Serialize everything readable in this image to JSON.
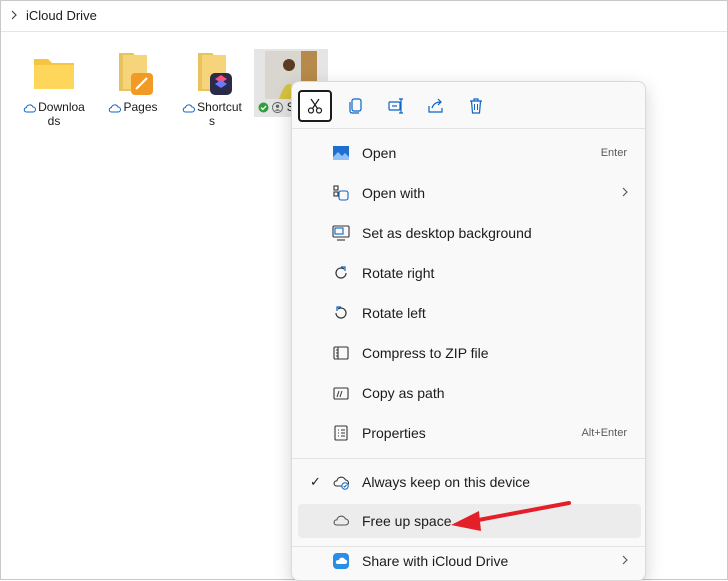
{
  "breadcrumb": {
    "location": "iCloud Drive"
  },
  "files": [
    {
      "name_line1": "Downloa",
      "name_line2": "ds",
      "type": "folder"
    },
    {
      "name_line1": "Pages",
      "name_line2": "",
      "type": "folder-app"
    },
    {
      "name_line1": "Shortcut",
      "name_line2": "s",
      "type": "folder-app"
    },
    {
      "name_line1": "S",
      "name_line2": "",
      "type": "image",
      "selected": true
    }
  ],
  "context_menu": {
    "toolbar": [
      "cut-icon",
      "copy-icon",
      "rename-icon",
      "share-icon",
      "delete-icon"
    ],
    "items": [
      {
        "label": "Open",
        "shortcut": "Enter",
        "icon": "image-icon"
      },
      {
        "label": "Open with",
        "shortcut": "",
        "icon": "open-with-icon",
        "submenu": true
      },
      {
        "label": "Set as desktop background",
        "shortcut": "",
        "icon": "desktop-background-icon"
      },
      {
        "label": "Rotate right",
        "shortcut": "",
        "icon": "rotate-right-icon"
      },
      {
        "label": "Rotate left",
        "shortcut": "",
        "icon": "rotate-left-icon"
      },
      {
        "label": "Compress to ZIP file",
        "shortcut": "",
        "icon": "zip-icon"
      },
      {
        "label": "Copy as path",
        "shortcut": "",
        "icon": "copy-path-icon"
      },
      {
        "label": "Properties",
        "shortcut": "Alt+Enter",
        "icon": "properties-icon"
      },
      {
        "label": "Always keep on this device",
        "shortcut": "",
        "icon": "cloud-sync-icon",
        "checked": true
      },
      {
        "label": "Free up space",
        "shortcut": "",
        "icon": "cloud-icon",
        "hover": true
      },
      {
        "label": "Share with iCloud Drive",
        "shortcut": "",
        "icon": "icloud-icon",
        "submenu": true
      }
    ],
    "check_mark": "✓"
  },
  "colors": {
    "annotation": "#e3202a",
    "accent": "#0a64c8"
  }
}
